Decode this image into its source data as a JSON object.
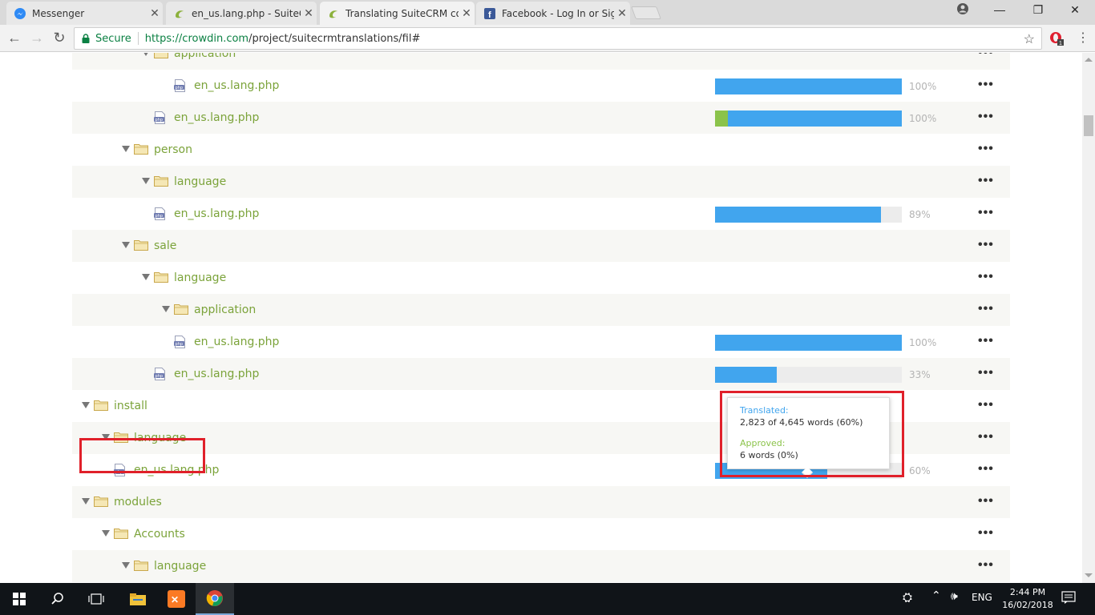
{
  "browser": {
    "tabs": [
      {
        "title": "Messenger",
        "icon": "messenger-icon"
      },
      {
        "title": "en_us.lang.php - SuiteCRM",
        "icon": "crowdin-icon"
      },
      {
        "title": "Translating SuiteCRM co",
        "icon": "crowdin-icon"
      },
      {
        "title": "Facebook - Log In or Sign",
        "icon": "facebook-icon"
      }
    ],
    "secure_label": "Secure",
    "url_scheme_host": "https://crowdin.com",
    "url_path": "/project/suitecrmtranslations/fil#"
  },
  "tree": [
    {
      "name": "application",
      "type": "folder",
      "depth": 5,
      "alt": true
    },
    {
      "name": "en_us.lang.php",
      "type": "file",
      "depth": 6,
      "alt": false,
      "translated": 100,
      "approved": 0,
      "pct": "100%"
    },
    {
      "name": "en_us.lang.php",
      "type": "file",
      "depth": 5,
      "alt": true,
      "translated": 100,
      "approved": 7,
      "pct": "100%"
    },
    {
      "name": "person",
      "type": "folder",
      "depth": 4,
      "alt": false
    },
    {
      "name": "language",
      "type": "folder",
      "depth": 5,
      "alt": true
    },
    {
      "name": "en_us.lang.php",
      "type": "file",
      "depth": 5,
      "alt": false,
      "translated": 89,
      "approved": 0,
      "pct": "89%"
    },
    {
      "name": "sale",
      "type": "folder",
      "depth": 4,
      "alt": true
    },
    {
      "name": "language",
      "type": "folder",
      "depth": 5,
      "alt": false
    },
    {
      "name": "application",
      "type": "folder",
      "depth": 6,
      "alt": true
    },
    {
      "name": "en_us.lang.php",
      "type": "file",
      "depth": 6,
      "alt": false,
      "translated": 100,
      "approved": 0,
      "pct": "100%"
    },
    {
      "name": "en_us.lang.php",
      "type": "file",
      "depth": 5,
      "alt": true,
      "translated": 33,
      "approved": 0,
      "pct": "33%"
    },
    {
      "name": "install",
      "type": "folder",
      "depth": 2,
      "alt": false
    },
    {
      "name": "language",
      "type": "folder",
      "depth": 3,
      "alt": true
    },
    {
      "name": "en_us.lang.php",
      "type": "file",
      "depth": 3,
      "alt": false,
      "translated": 60,
      "approved": 0,
      "pct": "60%"
    },
    {
      "name": "modules",
      "type": "folder",
      "depth": 2,
      "alt": true
    },
    {
      "name": "Accounts",
      "type": "folder",
      "depth": 3,
      "alt": false
    },
    {
      "name": "language",
      "type": "folder",
      "depth": 4,
      "alt": true
    }
  ],
  "tooltip": {
    "translated_label": "Translated:",
    "translated_value": "2,823 of 4,645 words (60%)",
    "approved_label": "Approved:",
    "approved_value": "6 words (0%)"
  },
  "taskbar": {
    "language": "ENG",
    "time": "2:44 PM",
    "date": "16/02/2018"
  },
  "colors": {
    "folder_name": "#7ba33a",
    "translated_bar": "#41a5ee",
    "approved_bar": "#8bc34a",
    "highlight": "#e0202a"
  }
}
